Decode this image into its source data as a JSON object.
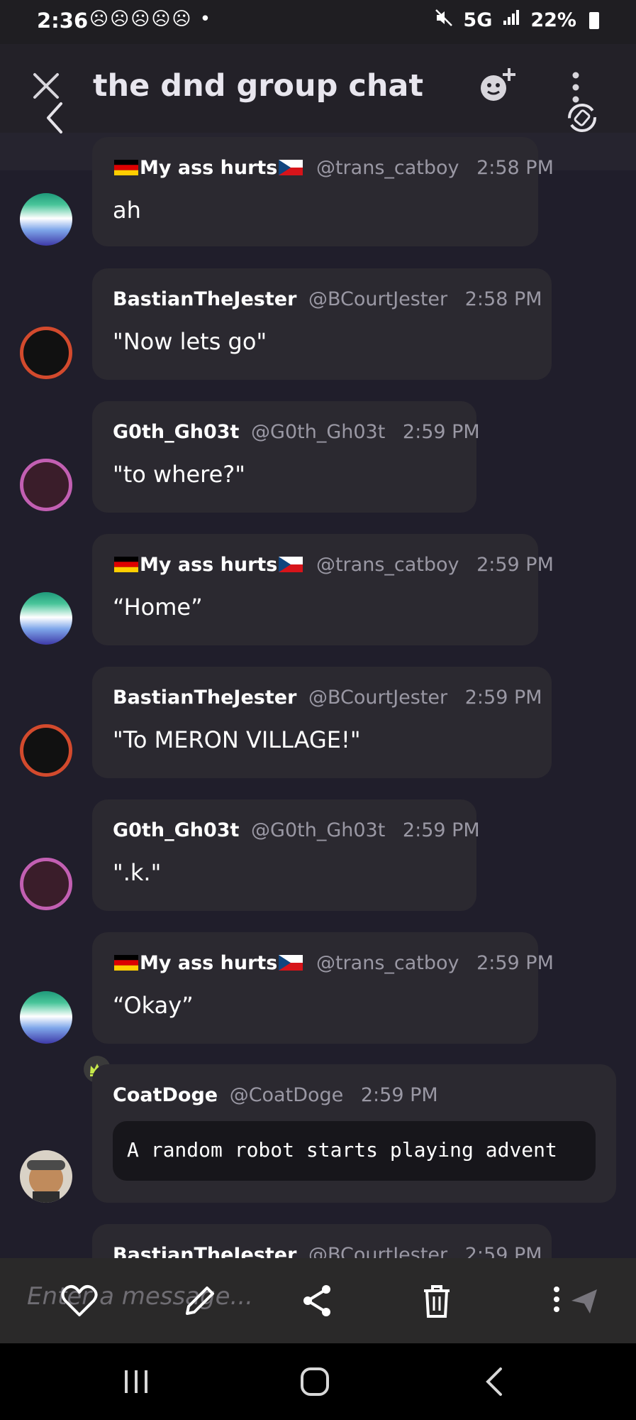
{
  "status_bar": {
    "time": "2:36",
    "notifications": "☹☹☹☹☹ •",
    "network": "5G",
    "battery": "22%"
  },
  "header": {
    "title": "the dnd group chat"
  },
  "messages": [
    {
      "author": "My ass hurts",
      "handle": "@trans_catboy",
      "time": "2:58 PM",
      "text": "ah"
    },
    {
      "author": "BastianTheJester",
      "handle": "@BCourtJester",
      "time": "2:58 PM",
      "text": "\"Now lets go\""
    },
    {
      "author": "G0th_Gh03t",
      "handle": "@G0th_Gh03t",
      "time": "2:59 PM",
      "text": "\"to where?\""
    },
    {
      "author": "My ass hurts",
      "handle": "@trans_catboy",
      "time": "2:59 PM",
      "text": "“Home”"
    },
    {
      "author": "BastianTheJester",
      "handle": "@BCourtJester",
      "time": "2:59 PM",
      "text": "\"To MERON VILLAGE!\""
    },
    {
      "author": "G0th_Gh03t",
      "handle": "@G0th_Gh03t",
      "time": "2:59 PM",
      "text": "\".k.\""
    },
    {
      "author": "My ass hurts",
      "handle": "@trans_catboy",
      "time": "2:59 PM",
      "text": "“Okay”"
    },
    {
      "author": "CoatDoge",
      "handle": "@CoatDoge",
      "time": "2:59 PM",
      "text": "A random robot starts playing advent"
    },
    {
      "author": "BastianTheJester",
      "handle": "@BCourtJester",
      "time": "2:59 PM",
      "text": ""
    }
  ],
  "composer": {
    "placeholder": "Enter a message..."
  },
  "colors": {
    "background": "#201e2b",
    "bubble": "#2b2930",
    "accent_crown": "#c6e84a"
  }
}
